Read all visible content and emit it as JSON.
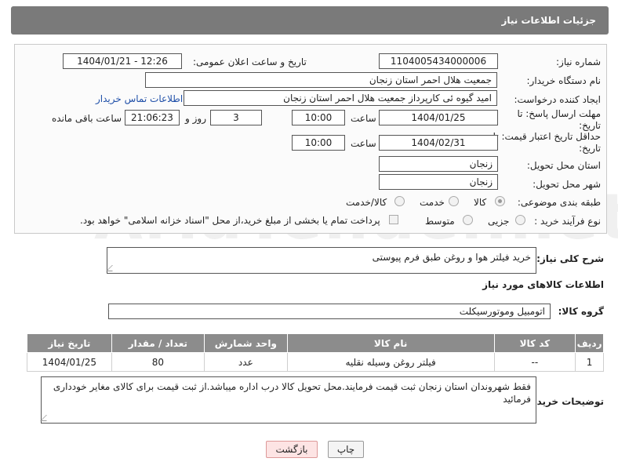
{
  "header": {
    "title": "جزئیات اطلاعات نیاز"
  },
  "watermark": "AriaTender.net",
  "fields": {
    "need_number_label": "شماره نیاز:",
    "need_number": "1104005434000006",
    "announce_label": "تاریخ و ساعت اعلان عمومی:",
    "announce_value": "1404/01/21 - 12:26",
    "buyer_org_label": "نام دستگاه خریدار:",
    "buyer_org": "جمعیت هلال احمر استان زنجان",
    "requester_label": "ایجاد کننده درخواست:",
    "requester": "امید گیوه ئی کارپرداز  جمعیت هلال احمر استان زنجان",
    "contact_link": "اطلاعات تماس خریدار",
    "deadline_label": "مهلت ارسال پاسخ: تا تاریخ:",
    "deadline_date": "1404/01/25",
    "time_label": "ساعت",
    "deadline_time": "10:00",
    "days_value": "3",
    "days_label": "روز و",
    "remaining_time": "21:06:23",
    "remaining_label": "ساعت باقی مانده",
    "price_valid_label": "حداقل تاریخ اعتبار قیمت: تا تاریخ:",
    "price_valid_date": "1404/02/31",
    "price_valid_time": "10:00",
    "delivery_province_label": "استان محل تحویل:",
    "delivery_province": "زنجان",
    "delivery_city_label": "شهر محل تحویل:",
    "delivery_city": "زنجان",
    "category_label": "طبقه بندی موضوعی:",
    "category_options": [
      "کالا",
      "خدمت",
      "کالا/خدمت"
    ],
    "process_label": "نوع فرآیند خرید :",
    "process_options": [
      "جزیی",
      "متوسط"
    ],
    "payment_note": "پرداخت تمام یا بخشی از مبلغ خرید،از محل \"اسناد خزانه اسلامی\" خواهد بود."
  },
  "description": {
    "label": "شرح کلی نیاز:",
    "value": "خرید فیلتر هوا و روغن طبق فرم پیوستی"
  },
  "goods_section": {
    "title": "اطلاعات کالاهای مورد نیاز",
    "group_label": "گروه کالا:",
    "group_value": "اتومبیل وموتورسیکلت",
    "columns": [
      "ردیف",
      "کد کالا",
      "نام کالا",
      "واحد شمارش",
      "تعداد / مقدار",
      "تاریخ نیاز"
    ],
    "rows": [
      {
        "row": "1",
        "code": "--",
        "name": "فیلتر روغن وسیله نقلیه",
        "unit": "عدد",
        "qty": "80",
        "date": "1404/01/25"
      }
    ]
  },
  "buyer_notes": {
    "label": "توضیحات خریدار:",
    "value": "فقط شهروندان استان زنجان ثبت قیمت فرمایند.محل تحویل کالا درب اداره میباشد.از ثبت قیمت برای کالای مغایر خودداری فرمائید"
  },
  "buttons": {
    "print": "چاپ",
    "back": "بازگشت"
  },
  "colors": {
    "header_bg": "#7a7a7a",
    "table_header_bg": "#8c8c8c",
    "link": "#1f4fa8",
    "back_button_bg": "#fde4e4"
  }
}
